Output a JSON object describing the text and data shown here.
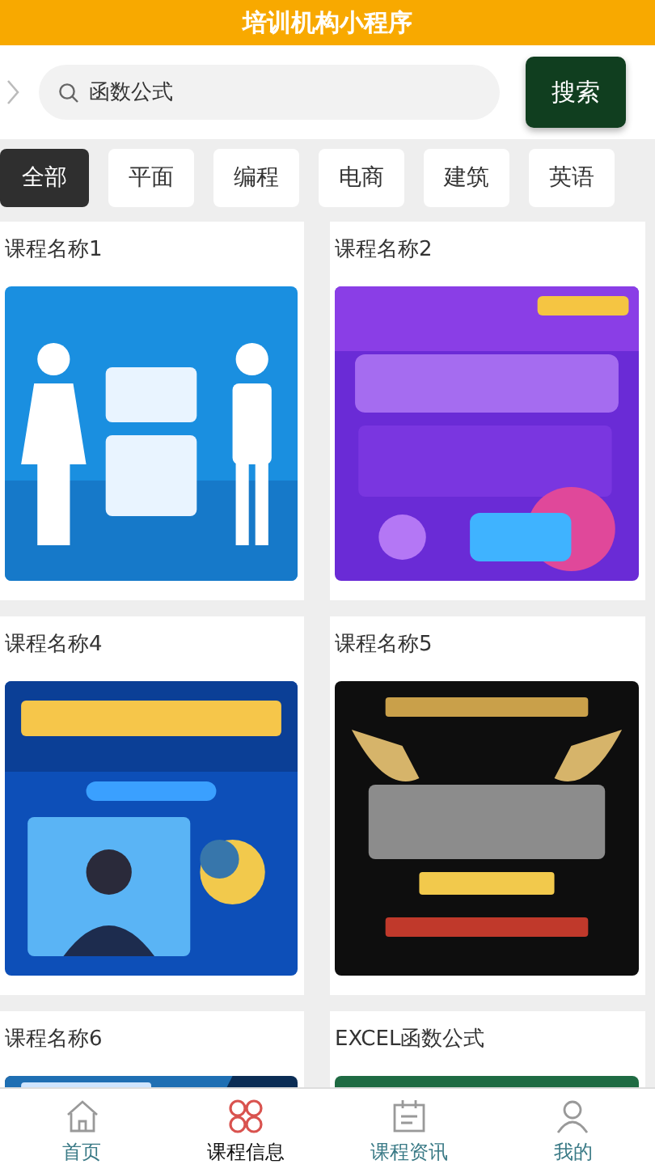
{
  "header": {
    "title": "培训机构小程序"
  },
  "search": {
    "value": "函数公式",
    "button": "搜索"
  },
  "categories": [
    {
      "label": "全部",
      "selected": true
    },
    {
      "label": "平面",
      "selected": false
    },
    {
      "label": "编程",
      "selected": false
    },
    {
      "label": "电商",
      "selected": false
    },
    {
      "label": "建筑",
      "selected": false
    },
    {
      "label": "英语",
      "selected": false
    }
  ],
  "courses": [
    {
      "name": "课程名称1",
      "kind": "picture"
    },
    {
      "name": "课程名称2",
      "kind": "picture"
    },
    {
      "name": "课程名称4",
      "kind": "picture"
    },
    {
      "name": "课程名称5",
      "kind": "picture"
    },
    {
      "name": "课程名称6",
      "kind": "picture"
    },
    {
      "name": "EXCEL函数公式",
      "kind": "picture"
    }
  ],
  "tab_bar": [
    {
      "label": "首页",
      "kind": "home",
      "selected": false
    },
    {
      "label": "课程信息",
      "kind": "grid",
      "selected": true
    },
    {
      "label": "课程资讯",
      "kind": "calendar",
      "selected": false
    },
    {
      "label": "我的",
      "kind": "person",
      "selected": false
    }
  ]
}
